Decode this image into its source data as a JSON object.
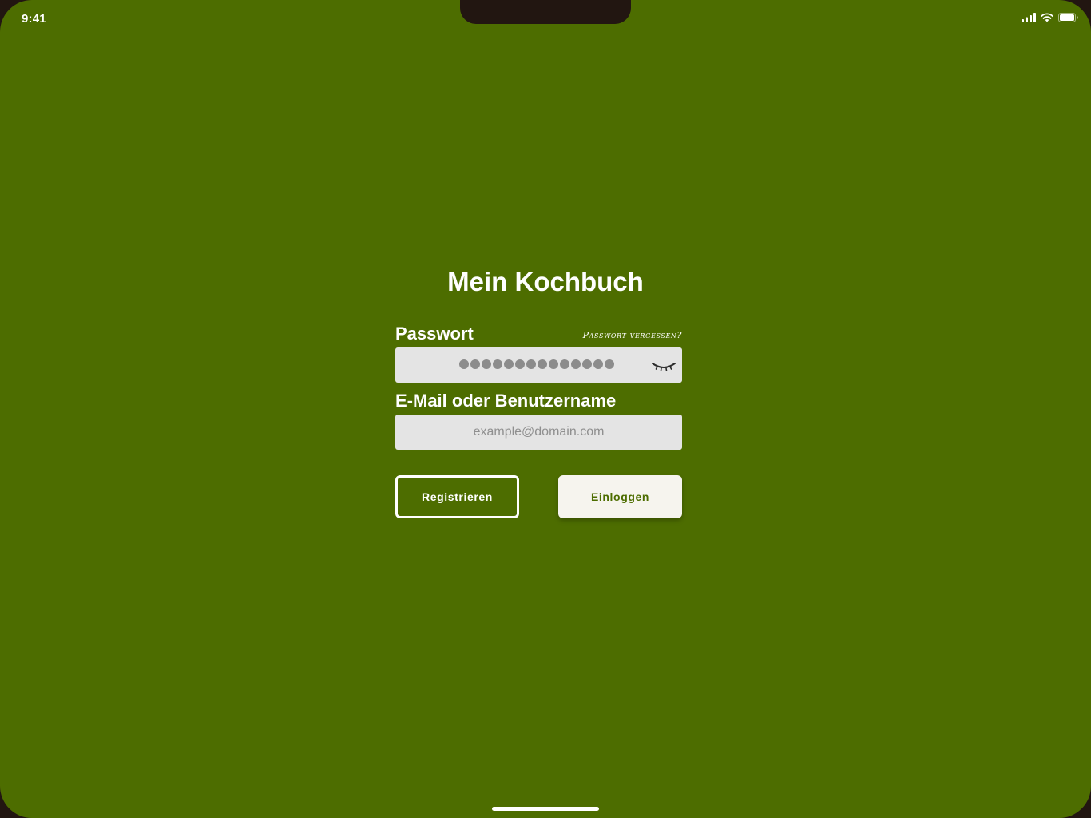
{
  "status_bar": {
    "time": "9:41",
    "icons": [
      "cellular-signal-icon",
      "wifi-icon",
      "battery-icon"
    ]
  },
  "app": {
    "title": "Mein Kochbuch"
  },
  "password": {
    "label": "Passwort",
    "forgot_link": "Passwort vergessen?",
    "masked_length": 14,
    "visibility_icon": "eye-closed-icon"
  },
  "email": {
    "label": "E-Mail oder Benutzername",
    "placeholder": "example@domain.com",
    "value": ""
  },
  "buttons": {
    "register": "Registrieren",
    "login": "Einloggen"
  },
  "colors": {
    "background": "#4d6d00",
    "input": "#e4e4e4",
    "login_button": "#f6f4ee"
  }
}
